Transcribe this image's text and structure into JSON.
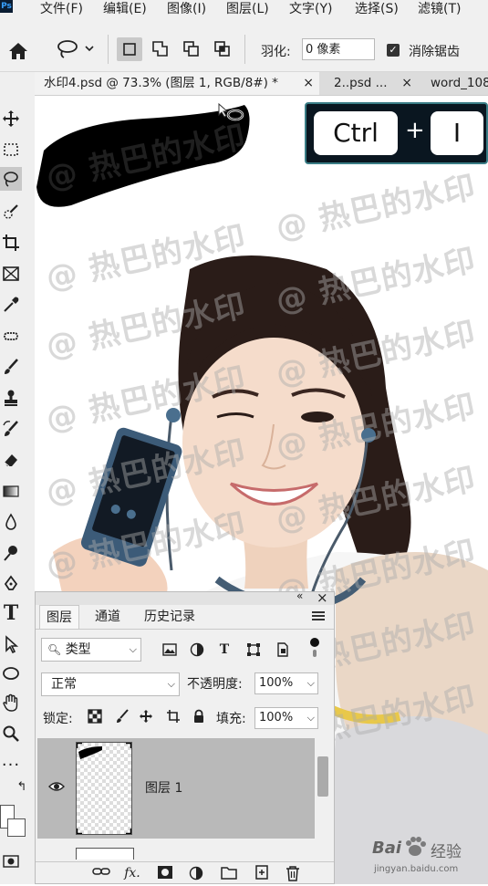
{
  "app": {
    "logo": "Ps"
  },
  "menu": [
    "文件(F)",
    "编辑(E)",
    "图像(I)",
    "图层(L)",
    "文字(Y)",
    "选择(S)",
    "滤镜(T)"
  ],
  "options": {
    "feather_label": "羽化:",
    "feather_value": "0 像素",
    "antialias_label": "消除锯齿",
    "antialias_checked": true
  },
  "tabs": [
    {
      "label": "水印4.psd @ 73.3% (图层 1, RGB/8#) *",
      "close": "×"
    },
    {
      "label": "2..psd ...",
      "close": "×"
    },
    {
      "label": "word_108"
    }
  ],
  "shortcut": {
    "key1": "Ctrl",
    "plus": "+",
    "key2": "I"
  },
  "watermark_text": "@ 热巴的水印",
  "layers_panel": {
    "collapse": "«",
    "close": "×",
    "tabs": [
      "图层",
      "通道",
      "历史记录"
    ],
    "filter_kind": "类型",
    "blend_mode": "正常",
    "opacity_label": "不透明度:",
    "opacity_value": "100%",
    "lock_label": "锁定:",
    "fill_label": "填充:",
    "fill_value": "100%",
    "layer_name": "图层 1"
  },
  "baidu": {
    "brand": "Bai",
    "brand2": "经验",
    "url": "jingyan.baidu.com"
  }
}
